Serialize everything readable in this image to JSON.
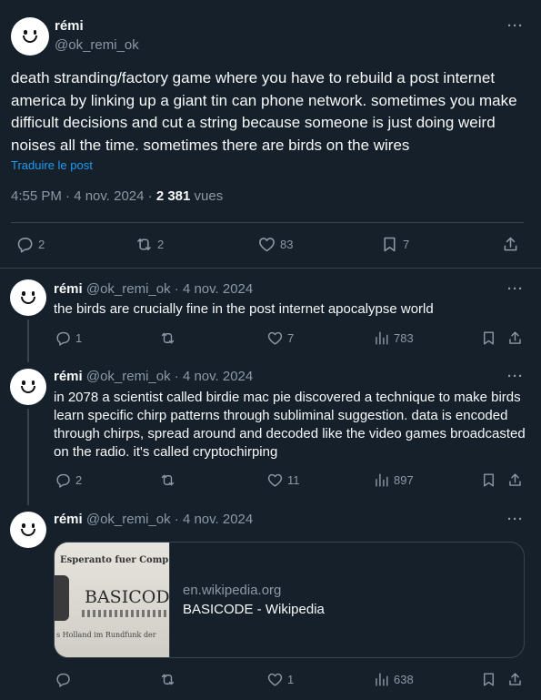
{
  "main_post": {
    "name": "rémi",
    "handle": "@ok_remi_ok",
    "text": "death stranding/factory game where you have to rebuild a post internet america by linking up a giant tin can phone network. sometimes you make difficult decisions and cut a string because someone is just doing weird noises all the time. sometimes there are birds on the wires",
    "translate_label": "Traduire le post",
    "time": "4:55 PM · 4 nov. 2024 · ",
    "views_count": "2 381",
    "views_label": " vues",
    "stats": {
      "replies": "2",
      "reposts": "2",
      "likes": "83",
      "bookmarks": "7"
    }
  },
  "replies": [
    {
      "name": "rémi",
      "handle": "@ok_remi_ok",
      "date": "· 4 nov. 2024",
      "text": "the birds are crucially fine in the post internet apocalypse world",
      "stats": {
        "replies": "1",
        "reposts": "",
        "likes": "7",
        "views": "783"
      }
    },
    {
      "name": "rémi",
      "handle": "@ok_remi_ok",
      "date": "· 4 nov. 2024",
      "text": "in 2078 a scientist called birdie mac pie discovered a technique to make birds learn specific chirp patterns through subliminal suggestion. data is encoded through chirps, spread around and decoded like the video games broadcasted on the radio. it's called cryptochirping",
      "stats": {
        "replies": "2",
        "reposts": "",
        "likes": "11",
        "views": "897"
      }
    },
    {
      "name": "rémi",
      "handle": "@ok_remi_ok",
      "date": "· 4 nov. 2024",
      "card": {
        "domain": "en.wikipedia.org",
        "title": "BASICODE - Wikipedia",
        "img_line1": "Esperanto fuer Comp",
        "img_line2": "BASICODE",
        "img_line3": "s Holland im Rundfunk der"
      },
      "stats": {
        "replies": "",
        "reposts": "",
        "likes": "1",
        "views": "638"
      }
    }
  ],
  "more_label": "···"
}
